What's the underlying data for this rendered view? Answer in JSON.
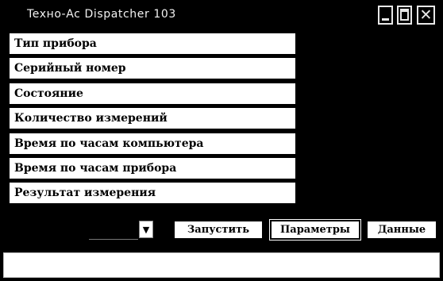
{
  "window": {
    "title": "Texно-Ac Dispatcher 103",
    "controls": {
      "minimize_icon": "minimize-icon",
      "maximize_icon": "maximize-icon",
      "close_icon": "close-icon",
      "close_glyph": "✕"
    }
  },
  "fields": [
    "Тип прибора",
    "Серийный номер",
    "Состояние",
    "Количество измерений",
    "Время по часам компьютера",
    "Время по часам прибора",
    "Результат измерения"
  ],
  "port_select": {
    "value": "",
    "arrow": "▼"
  },
  "buttons": {
    "run": "Запустить",
    "params": "Параметры",
    "data": "Данные"
  },
  "status": {
    "text": ""
  },
  "colors": {
    "background": "#000000",
    "field": "#ffffff",
    "text": "#000000",
    "title_text": "#f2f2f2"
  }
}
